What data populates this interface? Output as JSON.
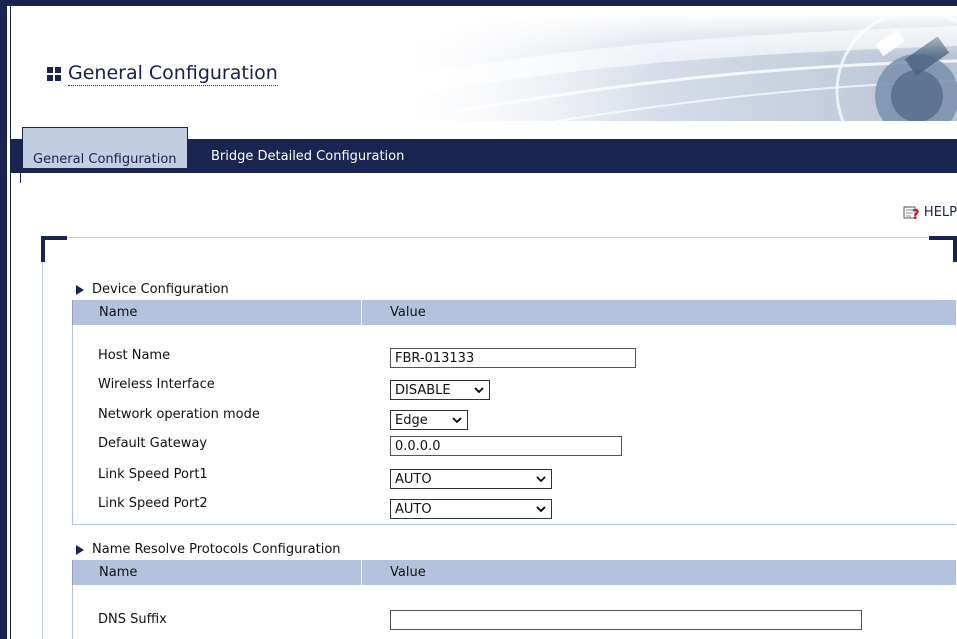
{
  "page": {
    "title": "General Configuration",
    "help_label": "HELP"
  },
  "tabs": [
    {
      "label": "General Configuration",
      "active": true
    },
    {
      "label": "Bridge Detailed Configuration",
      "active": false
    }
  ],
  "device_section": {
    "title": "Device Configuration",
    "col_name": "Name",
    "col_value": "Value",
    "rows": [
      {
        "label": "Host Name",
        "type": "text",
        "value": "FBR-013133"
      },
      {
        "label": "Wireless Interface",
        "type": "select",
        "value": "DISABLE"
      },
      {
        "label": "Network operation mode",
        "type": "select",
        "value": "Edge"
      },
      {
        "label": "Default Gateway",
        "type": "text",
        "value": "0.0.0.0"
      },
      {
        "label": "Link Speed Port1",
        "type": "select",
        "value": "AUTO"
      },
      {
        "label": "Link Speed Port2",
        "type": "select",
        "value": "AUTO"
      }
    ]
  },
  "dns_section": {
    "title": "Name Resolve Protocols Configuration",
    "col_name": "Name",
    "col_value": "Value",
    "rows": [
      {
        "label": "DNS Suffix",
        "type": "text",
        "value": ""
      }
    ]
  },
  "colors": {
    "navy": "#1a2450",
    "header_blue": "#b3c3dd",
    "tab_active": "#c3cee0"
  }
}
